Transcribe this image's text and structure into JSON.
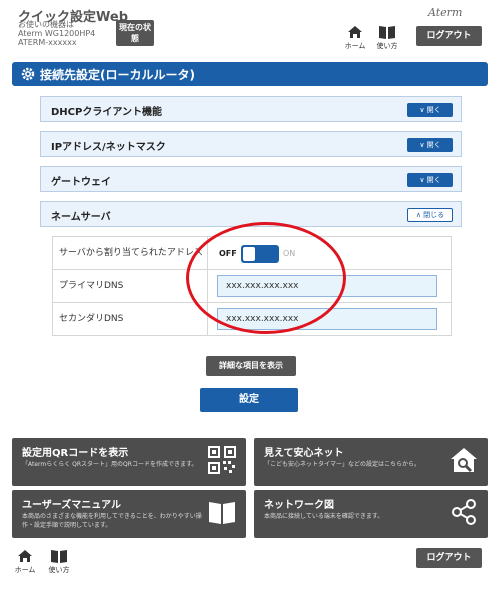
{
  "header": {
    "app_title": "クイック設定Web",
    "device_label": "お使いの機器は",
    "device_model": "Aterm WG1200HP4",
    "device_id": "ATERM-xxxxxx",
    "status_button": "現在の状態",
    "brand": "Aterm",
    "home_label": "ホーム",
    "help_label": "使い方",
    "logout_label": "ログアウト"
  },
  "section": {
    "title": "接続先設定(ローカルルータ)",
    "accent_color": "#1a5fa8"
  },
  "accordion": [
    {
      "label": "DHCPクライアント機能",
      "button": "開く"
    },
    {
      "label": "IPアドレス/ネットマスク",
      "button": "開く"
    },
    {
      "label": "ゲートウェイ",
      "button": "開く"
    },
    {
      "label": "ネームサーバ",
      "button": "閉じる"
    }
  ],
  "name_server": {
    "auto_assign_label": "サーバから割り当てられたアドレス",
    "switch_off": "OFF",
    "switch_on": "ON",
    "primary_label": "プライマリDNS",
    "primary_value": "xxx.xxx.xxx.xxx",
    "secondary_label": "セカンダリDNS",
    "secondary_value": "xxx.xxx.xxx.xxx"
  },
  "buttons": {
    "show_details": "詳細な項目を表示",
    "submit": "設定"
  },
  "tiles": [
    {
      "title": "設定用QRコードを表示",
      "desc": "「Atermらくらく QRスタート」用のQRコードを作成できます。",
      "icon": "qr-code-icon"
    },
    {
      "title": "見えて安心ネット",
      "desc": "「こども安心ネットタイマー」などの設定はこちらから。",
      "icon": "house-search-icon"
    },
    {
      "title": "ユーザーズマニュアル",
      "desc": "本商品のさまざまな機能を利用してできることを、わかりやすい操作・設定手順で説明しています。",
      "icon": "book-icon"
    },
    {
      "title": "ネットワーク図",
      "desc": "本商品に接続している端末を確認できます。",
      "icon": "share-network-icon"
    }
  ],
  "footer": {
    "home_label": "ホーム",
    "help_label": "使い方",
    "logout_label": "ログアウト"
  },
  "colors": {
    "highlight": "#e0141f",
    "dark_button": "#555555"
  }
}
